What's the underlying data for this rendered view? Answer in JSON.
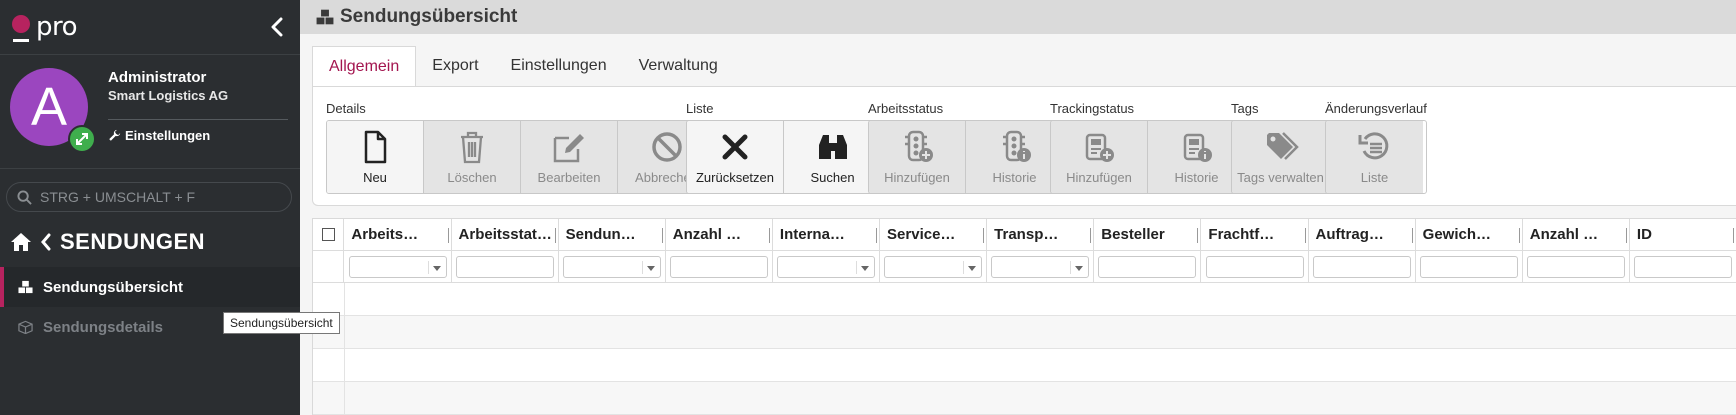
{
  "logo": {
    "text": "pro",
    "accent": "#b7235f"
  },
  "user": {
    "initial": "A",
    "name": "Administrator",
    "company": "Smart Logistics AG",
    "settings_label": "Einstellungen",
    "avatar_color": "#9b46bf",
    "badge_color": "#3fae4d"
  },
  "search": {
    "placeholder": "STRG + UMSCHALT + F"
  },
  "nav": {
    "section_title": "SENDUNGEN",
    "items": [
      {
        "label": "Sendungsübersicht",
        "active": true
      },
      {
        "label": "Sendungsdetails",
        "active": false
      }
    ]
  },
  "tooltip": {
    "text": "Sendungsübersicht"
  },
  "page": {
    "title": "Sendungsübersicht"
  },
  "tabs": [
    {
      "label": "Allgemein",
      "active": true
    },
    {
      "label": "Export",
      "active": false
    },
    {
      "label": "Einstellungen",
      "active": false
    },
    {
      "label": "Verwaltung",
      "active": false
    }
  ],
  "ribbon": {
    "groups": [
      {
        "label": "Details",
        "buttons": [
          {
            "label": "Neu",
            "icon": "document-icon",
            "enabled": true
          },
          {
            "label": "Löschen",
            "icon": "trash-icon",
            "enabled": false
          },
          {
            "label": "Bearbeiten",
            "icon": "edit-icon",
            "enabled": false
          },
          {
            "label": "Abbrechen",
            "icon": "cancel-icon",
            "enabled": false
          }
        ]
      },
      {
        "label": "Liste",
        "buttons": [
          {
            "label": "Zurücksetzen",
            "icon": "close-icon",
            "enabled": true
          },
          {
            "label": "Suchen",
            "icon": "binoculars-icon",
            "enabled": true
          }
        ]
      },
      {
        "label": "Arbeitsstatus",
        "buttons": [
          {
            "label": "Hinzufügen",
            "icon": "traffic-light-add-icon",
            "enabled": false
          },
          {
            "label": "Historie",
            "icon": "traffic-light-info-icon",
            "enabled": false
          }
        ]
      },
      {
        "label": "Trackingstatus",
        "buttons": [
          {
            "label": "Hinzufügen",
            "icon": "tracking-add-icon",
            "enabled": false
          },
          {
            "label": "Historie",
            "icon": "tracking-info-icon",
            "enabled": false
          }
        ]
      },
      {
        "label": "Tags",
        "buttons": [
          {
            "label": "Tags verwalten",
            "icon": "tags-icon",
            "enabled": false
          }
        ]
      },
      {
        "label": "Änderungsverlauf",
        "buttons": [
          {
            "label": "Liste",
            "icon": "history-icon",
            "enabled": false
          }
        ]
      }
    ]
  },
  "grid": {
    "columns": [
      {
        "label": "Arbeits…",
        "filter": "select"
      },
      {
        "label": "Arbeitsstat…",
        "filter": "text"
      },
      {
        "label": "Sendun…",
        "filter": "select"
      },
      {
        "label": "Anzahl …",
        "filter": "text"
      },
      {
        "label": "Interna…",
        "filter": "select"
      },
      {
        "label": "Service…",
        "filter": "select"
      },
      {
        "label": "Transp…",
        "filter": "select"
      },
      {
        "label": "Besteller",
        "filter": "text"
      },
      {
        "label": "Frachtf…",
        "filter": "text"
      },
      {
        "label": "Auftrag…",
        "filter": "text"
      },
      {
        "label": "Gewich…",
        "filter": "text"
      },
      {
        "label": "Anzahl …",
        "filter": "text"
      },
      {
        "label": "ID",
        "filter": "text"
      }
    ],
    "empty_rows": 4
  }
}
